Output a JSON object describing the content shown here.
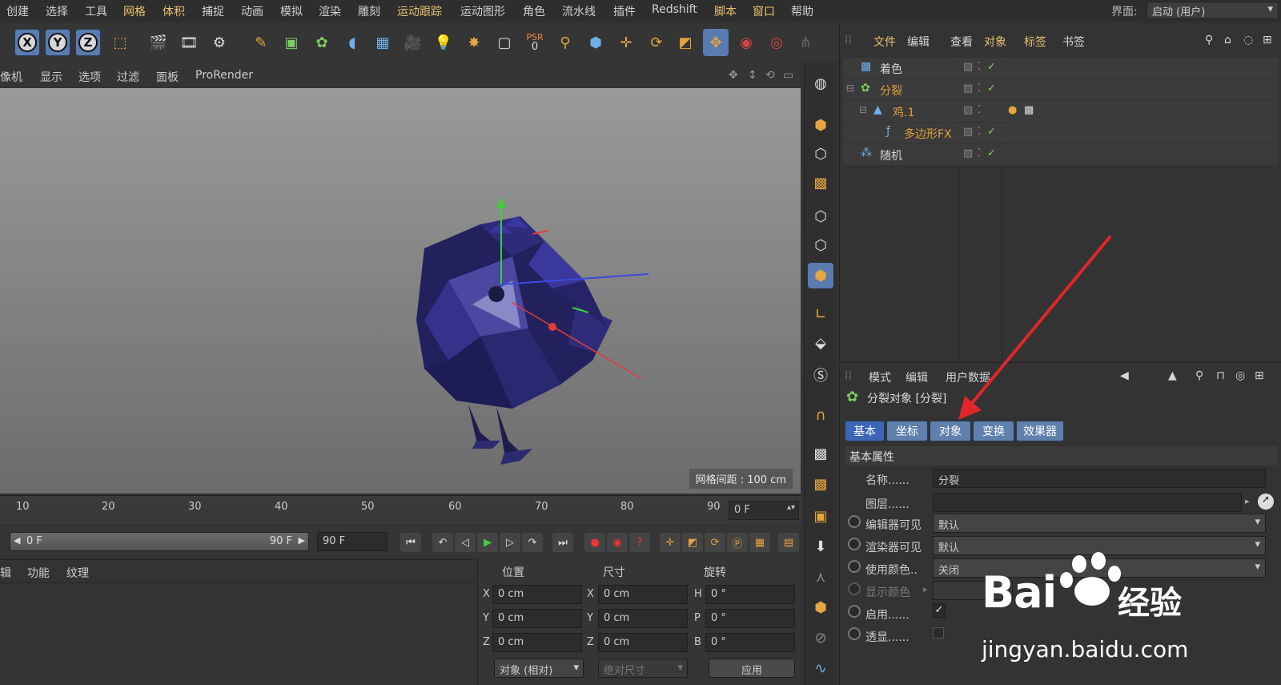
{
  "menubar": {
    "items": [
      "创建",
      "选择",
      "工具",
      "网格",
      "体积",
      "捕捉",
      "动画",
      "模拟",
      "渲染",
      "雕刻",
      "运动跟踪",
      "运动图形",
      "角色",
      "流水线",
      "插件",
      "Redshift",
      "脚本",
      "窗口",
      "帮助"
    ],
    "layout_label": "界面:",
    "layout_value": "启动 (用户)"
  },
  "toolbar": {
    "axis_x": "X",
    "axis_y": "Y",
    "axis_z": "Z",
    "psr_label": "PSR",
    "psr_value": "0"
  },
  "viewport_menu": [
    "像机",
    "显示",
    "选项",
    "过滤",
    "面板",
    "ProRender"
  ],
  "viewport": {
    "grid_info": "网格间距 : 100 cm"
  },
  "timeline": {
    "ticks": [
      "10",
      "20",
      "30",
      "40",
      "50",
      "60",
      "70",
      "80",
      "90"
    ],
    "current_frame": "0 F"
  },
  "transport": {
    "range_start": "0 F",
    "range_end": "90 F",
    "end_frame": "90 F"
  },
  "material_tabs": [
    "辑",
    "功能",
    "纹理"
  ],
  "coords": {
    "headers": [
      "位置",
      "尺寸",
      "旋转"
    ],
    "pos_axes": [
      "X",
      "Y",
      "Z"
    ],
    "size_axes": [
      "X",
      "Y",
      "Z"
    ],
    "rot_axes": [
      "H",
      "P",
      "B"
    ],
    "pos_values": [
      "0 cm",
      "0 cm",
      "0 cm"
    ],
    "size_values": [
      "0 cm",
      "0 cm",
      "0 cm"
    ],
    "rot_values": [
      "0 °",
      "0 °",
      "0 °"
    ],
    "mode_select": "对象 (相对)",
    "size_select": "绝对尺寸",
    "apply_button": "应用"
  },
  "object_manager": {
    "menu": [
      "文件",
      "编辑",
      "查看",
      "对象",
      "标签",
      "书签"
    ],
    "rows": [
      {
        "name": "着色"
      },
      {
        "name": "分裂"
      },
      {
        "name": "鸡.1"
      },
      {
        "name": "多边形FX"
      },
      {
        "name": "随机"
      }
    ]
  },
  "attribute_manager": {
    "menu": [
      "模式",
      "编辑",
      "用户数据"
    ],
    "object_title": "分裂对象 [分裂]",
    "tabs": [
      "基本",
      "坐标",
      "对象",
      "变换",
      "效果器"
    ],
    "section": "基本属性",
    "props": [
      {
        "label": "名称......",
        "value": "分裂"
      },
      {
        "label": "图层......",
        "value": ""
      },
      {
        "label": "编辑器可见",
        "value": "默认"
      },
      {
        "label": "渲染器可见",
        "value": "默认"
      },
      {
        "label": "使用颜色..",
        "value": "关闭"
      },
      {
        "label": "显示颜色",
        "value": ""
      },
      {
        "label": "启用......",
        "value": "✓"
      },
      {
        "label": "透显......",
        "value": ""
      }
    ]
  },
  "watermark": {
    "brand": "Bai",
    "brand_suffix": "经验",
    "url": "jingyan.baidu.com"
  }
}
